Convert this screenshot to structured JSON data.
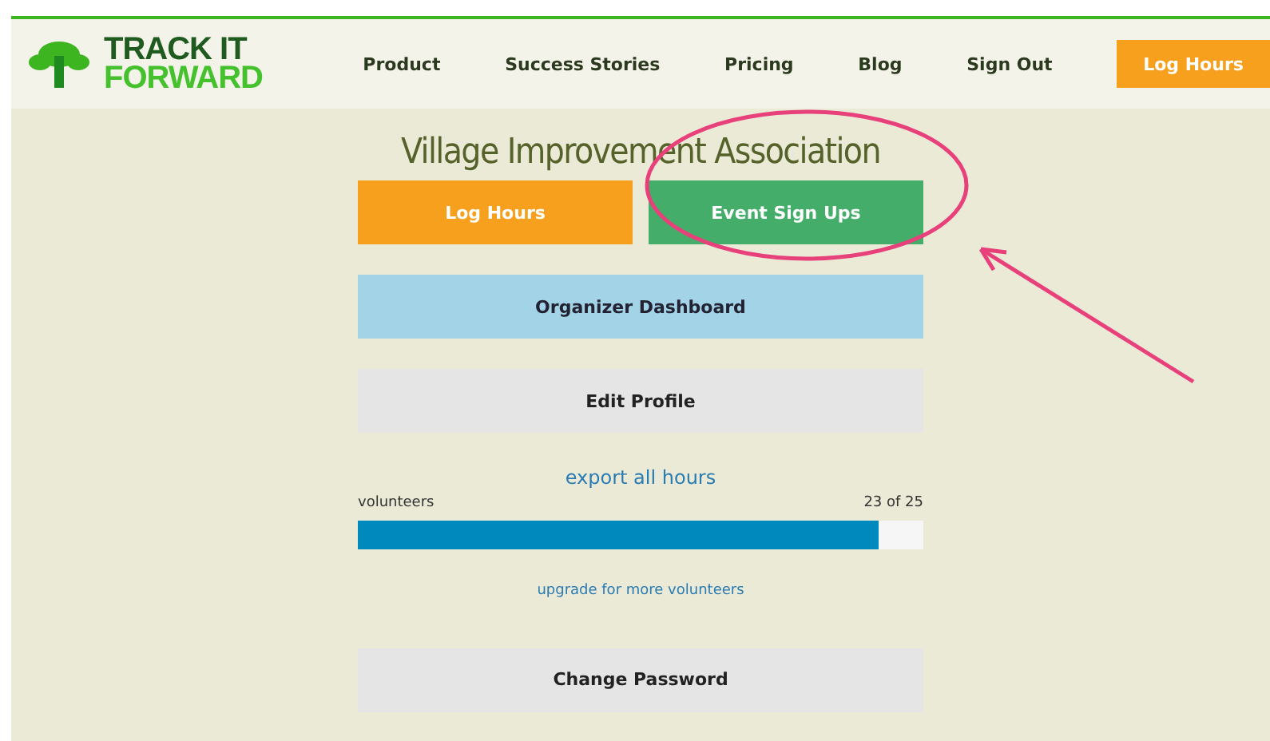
{
  "logo": {
    "line_1": "TRACK IT",
    "line_2": "FORWARD"
  },
  "nav": [
    {
      "label": "Product"
    },
    {
      "label": "Success Stories"
    },
    {
      "label": "Pricing"
    },
    {
      "label": "Blog"
    },
    {
      "label": "Sign Out"
    }
  ],
  "header_button": "Log Hours",
  "title": "Village Improvement Association",
  "actions": [
    {
      "label": "Log Hours",
      "kind": "orange"
    },
    {
      "label": "Event Sign Ups",
      "kind": "green"
    }
  ],
  "panels": [
    {
      "label": "Organizer Dashboard",
      "kind": "blue"
    },
    {
      "label": "Edit Profile",
      "kind": "grey"
    }
  ],
  "export_link": "export all hours",
  "volunteers": {
    "label": "volunteers",
    "reading": "23 of 25",
    "level": 0.92
  },
  "upgrade_link": "upgrade for more volunteers",
  "bottom_button": {
    "label": "Change Password",
    "kind": "grey"
  }
}
